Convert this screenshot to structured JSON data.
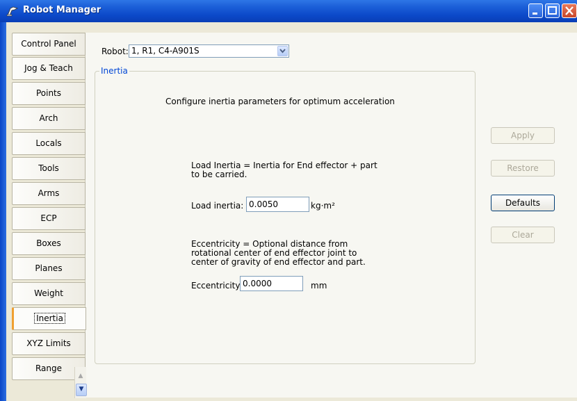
{
  "window": {
    "title": "Robot Manager"
  },
  "tabs": [
    {
      "label": "Control Panel"
    },
    {
      "label": "Jog & Teach"
    },
    {
      "label": "Points"
    },
    {
      "label": "Arch"
    },
    {
      "label": "Locals"
    },
    {
      "label": "Tools"
    },
    {
      "label": "Arms"
    },
    {
      "label": "ECP"
    },
    {
      "label": "Boxes"
    },
    {
      "label": "Planes"
    },
    {
      "label": "Weight"
    },
    {
      "label": "Inertia",
      "active": true
    },
    {
      "label": "XYZ Limits"
    },
    {
      "label": "Range"
    }
  ],
  "robot": {
    "label": "Robot:",
    "selected": "1, R1, C4-A901S"
  },
  "group": {
    "title": "Inertia",
    "description": "Configure inertia parameters for optimum acceleration",
    "load_help_line1": "Load Inertia = Inertia for End effector + part",
    "load_help_line2": "to be carried.",
    "load_label": "Load inertia:",
    "load_value": "0.0050",
    "load_unit": "kg·m²",
    "ecc_help_line1": "Eccentricity = Optional distance from",
    "ecc_help_line2": "rotational center of end effector joint to",
    "ecc_help_line3": "center of gravity of end effector and part.",
    "ecc_label": "Eccentricity:",
    "ecc_value": "0.0000",
    "ecc_unit": "mm"
  },
  "buttons": {
    "apply": "Apply",
    "restore": "Restore",
    "defaults": "Defaults",
    "clear": "Clear"
  },
  "colors": {
    "titlebar": "#0b48c8",
    "group_title": "#0046d5",
    "active_tab_marker": "#f0a030"
  }
}
